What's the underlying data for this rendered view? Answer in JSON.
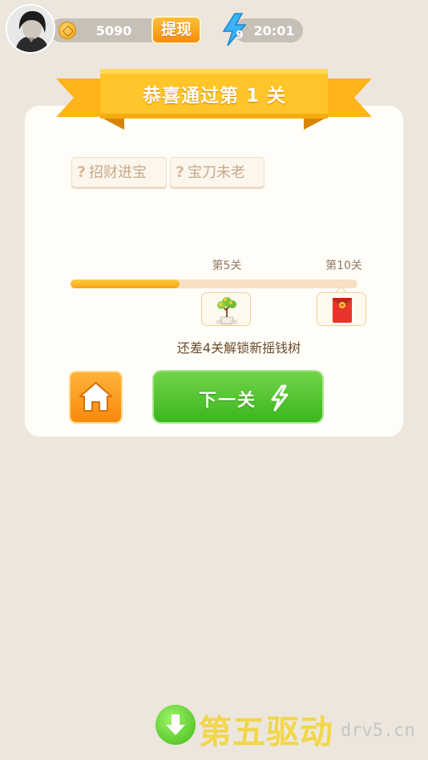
{
  "header": {
    "coin_value": "5090",
    "withdraw_label": "提现",
    "energy_count": "9",
    "timer": "20:01"
  },
  "level_complete": {
    "title": "恭喜通过第 1 关"
  },
  "tags": [
    {
      "icon": "question-mark",
      "label": "招财进宝"
    },
    {
      "icon": "question-mark",
      "label": "宝刀未老"
    }
  ],
  "progress": {
    "milestone_a": "第5关",
    "milestone_b": "第10关",
    "fill_fraction": 0.38,
    "milestone_a_reward": "money-tree-icon",
    "milestone_b_reward": "red-envelope-icon",
    "hint": "还差4关解锁新摇钱树"
  },
  "actions": {
    "home_icon": "home-icon",
    "next_label": "下一关"
  },
  "watermark": {
    "text": "第五驱动",
    "domain": "drv5.cn"
  },
  "colors": {
    "background": "#ece6dc",
    "accent_orange": "#f58f0c",
    "ribbon": "#ffc021",
    "next_green": "#3bb61f",
    "progress_fill": "#f5a516"
  }
}
